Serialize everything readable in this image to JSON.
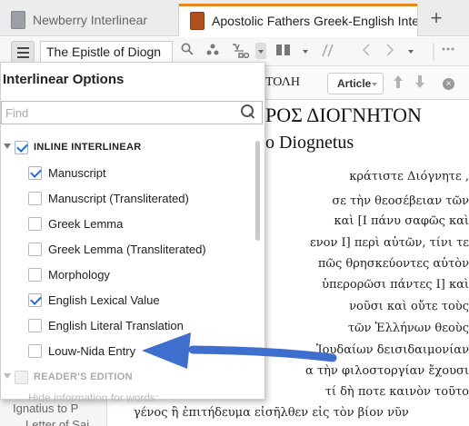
{
  "tabs": [
    {
      "label": "Newberry Interlinear"
    },
    {
      "label": "Apostolic Fathers Greek-English Interlinear"
    }
  ],
  "new_tab_label": "+",
  "toolbar": {
    "reference_value": "The Epistle of Diogn"
  },
  "sidebar": {
    "items": [
      "Ignatius to P",
      "Letter of Sai"
    ]
  },
  "reader": {
    "head_text": "ΤΟΛΗ",
    "article_label": "Article",
    "title": "ΡΟΣ ΔΙΟΓΝΗΤΟΝ",
    "subtitle": "o Diognetus",
    "lines": [
      "κράτιστε  Διόγνητε ,",
      "σε  τὴν θεοσέβειαν  τῶν",
      "καὶ [I πάνυ σαφῶς καὶ",
      "ενον I] περὶ αὐτῶν, τίνι τε",
      "πῶς θρησκεύοντες αὐτὸν",
      "ὑπερορῶσι  πάντες I] καὶ",
      "νοῦσι  καὶ  οὔτε  τοὺς",
      "τῶν Ἑλλήνων θεοὺς",
      "Ἰουδαίων δεισιδαιμονίαν",
      "α τὴν φιλοστοργίαν ἔχουσι",
      "τί δὴ ποτε καινὸν τοῦτο",
      "γένος ἢ ἐπιτήδευμα εἰσῆλθεν εἰς τὸν βίον νῦν"
    ]
  },
  "panel": {
    "title": "Interlinear Options",
    "find_placeholder": "Find",
    "group_label": "INLINE INTERLINEAR",
    "options": [
      {
        "label": "Manuscript",
        "checked": true
      },
      {
        "label": "Manuscript (Transliterated)",
        "checked": false
      },
      {
        "label": "Greek Lemma",
        "checked": false
      },
      {
        "label": "Greek Lemma (Transliterated)",
        "checked": false
      },
      {
        "label": "Morphology",
        "checked": false
      },
      {
        "label": "English Lexical Value",
        "checked": true
      },
      {
        "label": "English Literal Translation",
        "checked": false
      },
      {
        "label": "Louw-Nida Entry",
        "checked": false
      }
    ],
    "reader_group_label": "READER'S EDITION",
    "hint": "Hide information for words:"
  },
  "colors": {
    "tab_accent": "#e8871e",
    "check": "#1e6fd9",
    "annotation_arrow": "#3f6fce"
  }
}
